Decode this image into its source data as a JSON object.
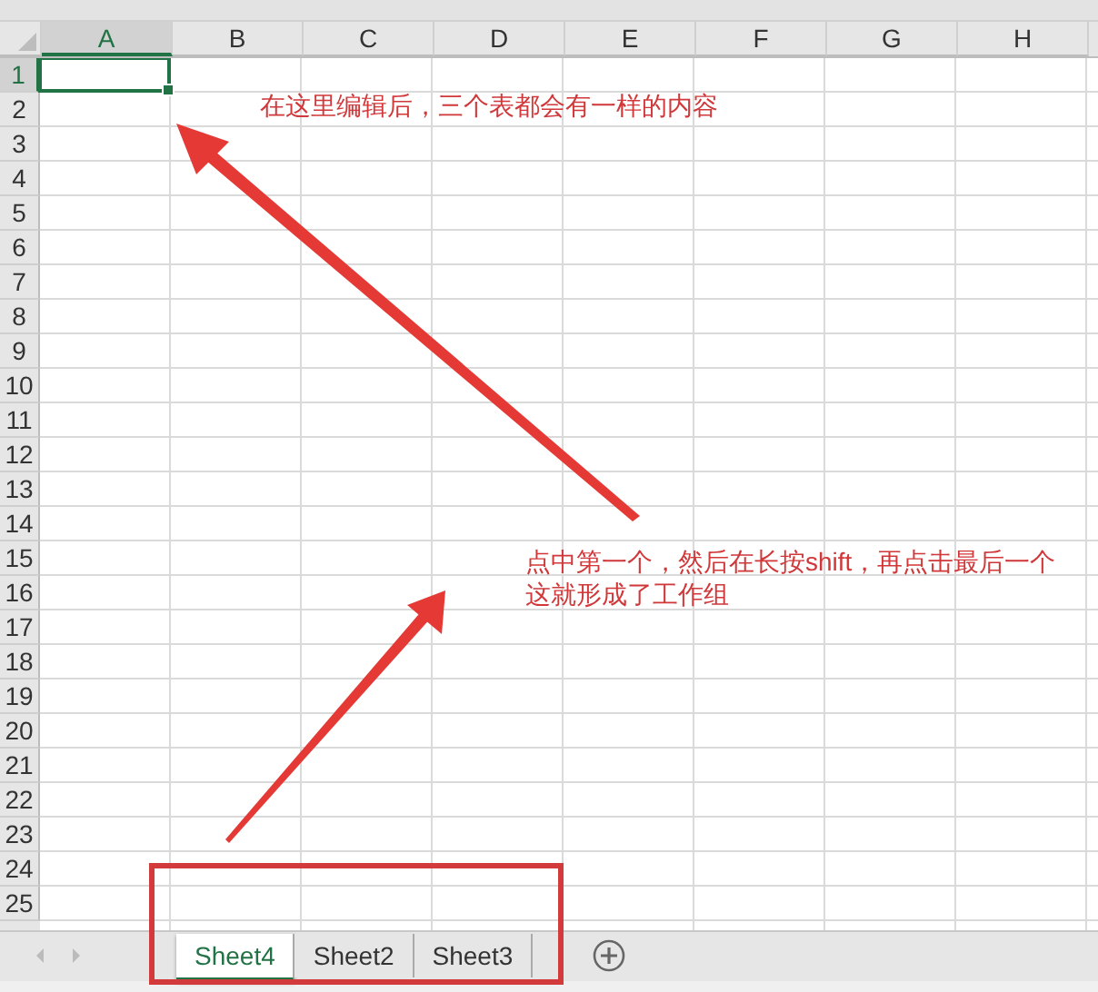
{
  "columns": [
    {
      "label": "A",
      "selected": true
    },
    {
      "label": "B",
      "selected": false
    },
    {
      "label": "C",
      "selected": false
    },
    {
      "label": "D",
      "selected": false
    },
    {
      "label": "E",
      "selected": false
    },
    {
      "label": "F",
      "selected": false
    },
    {
      "label": "G",
      "selected": false
    },
    {
      "label": "H",
      "selected": false
    }
  ],
  "rows": [
    {
      "label": "1",
      "selected": true
    },
    {
      "label": "2",
      "selected": false
    },
    {
      "label": "3",
      "selected": false
    },
    {
      "label": "4",
      "selected": false
    },
    {
      "label": "5",
      "selected": false
    },
    {
      "label": "6",
      "selected": false
    },
    {
      "label": "7",
      "selected": false
    },
    {
      "label": "8",
      "selected": false
    },
    {
      "label": "9",
      "selected": false
    },
    {
      "label": "10",
      "selected": false
    },
    {
      "label": "11",
      "selected": false
    },
    {
      "label": "12",
      "selected": false
    },
    {
      "label": "13",
      "selected": false
    },
    {
      "label": "14",
      "selected": false
    },
    {
      "label": "15",
      "selected": false
    },
    {
      "label": "16",
      "selected": false
    },
    {
      "label": "17",
      "selected": false
    },
    {
      "label": "18",
      "selected": false
    },
    {
      "label": "19",
      "selected": false
    },
    {
      "label": "20",
      "selected": false
    },
    {
      "label": "21",
      "selected": false
    },
    {
      "label": "22",
      "selected": false
    },
    {
      "label": "23",
      "selected": false
    },
    {
      "label": "24",
      "selected": false
    },
    {
      "label": "25",
      "selected": false
    }
  ],
  "annotations": [
    {
      "lines": [
        "在这里编辑后，三个表都会有一样的内容"
      ]
    },
    {
      "lines": [
        "点中第一个，然后在长按shift，再点击最后一个",
        "这就形成了工作组"
      ]
    }
  ],
  "sheet_tabs": [
    {
      "label": "Sheet4",
      "selected": true
    },
    {
      "label": "Sheet2",
      "selected": false
    },
    {
      "label": "Sheet3",
      "selected": false
    }
  ]
}
